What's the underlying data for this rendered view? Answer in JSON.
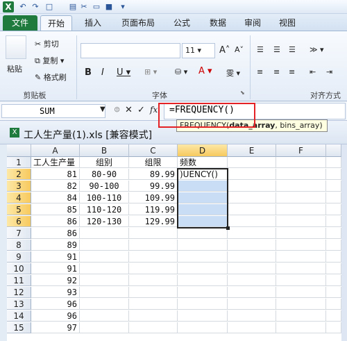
{
  "qat": {
    "app_icon": "X",
    "icons": [
      "undo-icon",
      "redo-icon",
      "new-file-icon",
      "cut-icon",
      "new-doc-icon",
      "save-icon",
      "customize-icon"
    ]
  },
  "tabs": [
    "文件",
    "开始",
    "插入",
    "页面布局",
    "公式",
    "数据",
    "审阅",
    "视图"
  ],
  "ribbon": {
    "clipboard": {
      "paste": "粘贴",
      "cut": "剪切",
      "copy": "复制 ▾",
      "format_painter": "格式刷",
      "group": "剪贴板"
    },
    "font": {
      "size": "11",
      "group": "字体"
    },
    "alignment": {
      "group": "对齐方式"
    }
  },
  "formula_bar": {
    "name_box": "SUM",
    "fx": "fx",
    "formula": "=FREQUENCY()"
  },
  "tooltip": {
    "fn": "FREQUENCY(",
    "arg1": "data_array",
    "rest": ", bins_array)"
  },
  "window": {
    "title": "工人生产量(1).xls  [兼容模式]"
  },
  "columns": [
    "A",
    "B",
    "C",
    "D",
    "E",
    "F"
  ],
  "rows": [
    {
      "n": "1",
      "a": "工人生产量",
      "b": "组别",
      "c": "组限",
      "d": "频数"
    },
    {
      "n": "2",
      "a": "81",
      "b": "80-90",
      "c": "89.99",
      "d": ")UENCY()"
    },
    {
      "n": "3",
      "a": "82",
      "b": "90-100",
      "c": "99.99",
      "d": ""
    },
    {
      "n": "4",
      "a": "84",
      "b": "100-110",
      "c": "109.99",
      "d": ""
    },
    {
      "n": "5",
      "a": "85",
      "b": "110-120",
      "c": "119.99",
      "d": ""
    },
    {
      "n": "6",
      "a": "86",
      "b": "120-130",
      "c": "129.99",
      "d": ""
    },
    {
      "n": "7",
      "a": "86",
      "b": "",
      "c": "",
      "d": ""
    },
    {
      "n": "8",
      "a": "89",
      "b": "",
      "c": "",
      "d": ""
    },
    {
      "n": "9",
      "a": "91",
      "b": "",
      "c": "",
      "d": ""
    },
    {
      "n": "10",
      "a": "91",
      "b": "",
      "c": "",
      "d": ""
    },
    {
      "n": "11",
      "a": "92",
      "b": "",
      "c": "",
      "d": ""
    },
    {
      "n": "12",
      "a": "93",
      "b": "",
      "c": "",
      "d": ""
    },
    {
      "n": "13",
      "a": "96",
      "b": "",
      "c": "",
      "d": ""
    },
    {
      "n": "14",
      "a": "96",
      "b": "",
      "c": "",
      "d": ""
    },
    {
      "n": "15",
      "a": "97",
      "b": "",
      "c": "",
      "d": ""
    }
  ],
  "colors": {
    "selection": "#c9def5",
    "highlight_box": "#e42124",
    "file_tab": "#1f7a3e"
  }
}
